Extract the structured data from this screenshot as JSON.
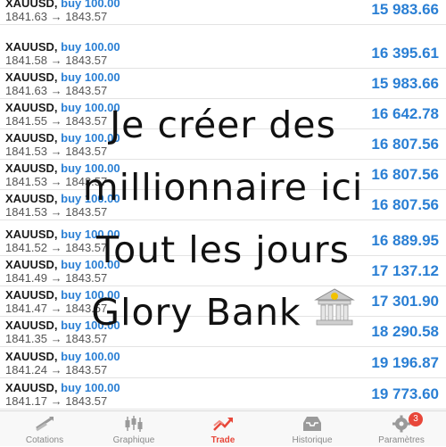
{
  "trades": [
    {
      "symbol": "XAUUSD,",
      "action": "buy 100.00",
      "open": "1841.63",
      "close": "1843.57",
      "profit": "15 983.66"
    },
    {
      "symbol": "XAUUSD,",
      "action": "buy 100.00",
      "open": "1841.58",
      "close": "1843.57",
      "profit": "16 395.61"
    },
    {
      "symbol": "XAUUSD,",
      "action": "buy 100.00",
      "open": "1841.63",
      "close": "1843.57",
      "profit": "15 983.66"
    },
    {
      "symbol": "XAUUSD,",
      "action": "buy 100.00",
      "open": "1841.55",
      "close": "1843.57",
      "profit": "16 642.78"
    },
    {
      "symbol": "XAUUSD,",
      "action": "buy 100.00",
      "open": "1841.53",
      "close": "1843.57",
      "profit": "16 807.56"
    },
    {
      "symbol": "XAUUSD,",
      "action": "buy 100.00",
      "open": "1841.53",
      "close": "1843.57",
      "profit": "16 807.56"
    },
    {
      "symbol": "XAUUSD,",
      "action": "buy 100.00",
      "open": "1841.53",
      "close": "1843.57",
      "profit": "16 807.56"
    },
    {
      "symbol": "XAUUSD,",
      "action": "buy 100.00",
      "open": "1841.52",
      "close": "1843.57",
      "profit": "16 889.95"
    },
    {
      "symbol": "XAUUSD,",
      "action": "buy 100.00",
      "open": "1841.49",
      "close": "1843.57",
      "profit": "17 137.12"
    },
    {
      "symbol": "XAUUSD,",
      "action": "buy 100.00",
      "open": "1841.47",
      "close": "1843.57",
      "profit": "17 301.90"
    },
    {
      "symbol": "XAUUSD,",
      "action": "buy 100.00",
      "open": "1841.35",
      "close": "1843.57",
      "profit": "18 290.58"
    },
    {
      "symbol": "XAUUSD,",
      "action": "buy 100.00",
      "open": "1841.24",
      "close": "1843.57",
      "profit": "19 196.87"
    },
    {
      "symbol": "XAUUSD,",
      "action": "buy 100.00",
      "open": "1841.17",
      "close": "1843.57",
      "profit": "19 773.60"
    }
  ],
  "arrow": "→",
  "overlay": {
    "line1": "Je créer des",
    "line2": "millionnaire ici",
    "line3": "Tout les jours",
    "line4": "Glory Bank",
    "emoji": "bank-building-icon"
  },
  "tabs": [
    {
      "label": "Cotations",
      "icon": "quotes-icon"
    },
    {
      "label": "Graphique",
      "icon": "candlestick-chart-icon"
    },
    {
      "label": "Trade",
      "icon": "trade-icon"
    },
    {
      "label": "Historique",
      "icon": "history-icon"
    },
    {
      "label": "Paramètres",
      "icon": "settings-gear-icon",
      "badge": "3"
    }
  ],
  "colors": {
    "accent": "#2a7fd4",
    "active_tab": "#e8473a",
    "badge": "#e8473a"
  }
}
